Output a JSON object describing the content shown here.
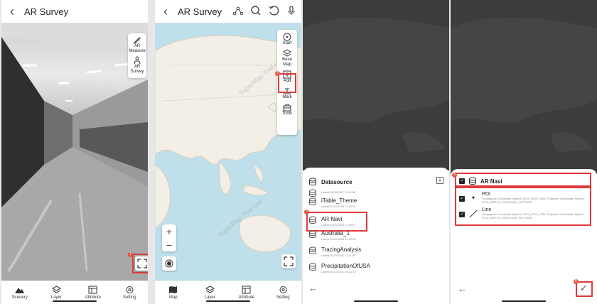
{
  "screen1": {
    "title": "AR Survey",
    "tools": [
      "AR Measure",
      "AR Survey"
    ],
    "badge": "1",
    "tabs": [
      "Scenery",
      "Layer",
      "Attribute",
      "Setting"
    ]
  },
  "screen2": {
    "title": "AR Survey",
    "tools": [
      "Start",
      "Base Map",
      "Add",
      "Mark",
      "Tools"
    ],
    "badge": "2",
    "tabs": [
      "Map",
      "Layer",
      "Attribute",
      "Setting"
    ],
    "watermark": "SuperMap Trial Use"
  },
  "screen3": {
    "heading": "Datasource",
    "badge": "3",
    "items": [
      {
        "name": "",
        "date": "Latest:2022/10/17 11:11:58"
      },
      {
        "name": "iTable_Theme",
        "date": "Latest:2022/10/28 11:15:55"
      },
      {
        "name": "AR Navi",
        "date": "Latest:2022/11/08 17:29:47"
      },
      {
        "name": "Australia_1",
        "date": "Latest:2022/10/28 10:41:53"
      },
      {
        "name": "TracingAnalysis",
        "date": "Latest:2022/10/31 11:11:50"
      },
      {
        "name": "PrecipitationOfUSA",
        "date": "Latest:2022/10/31 16:21:13"
      }
    ]
  },
  "screen4": {
    "group": "AR Navi",
    "badge_group": "4",
    "badge_confirm": "5",
    "layers": [
      {
        "name": "POI",
        "desc": "Geographic Coordinate System: GCS_WGS_1984, Projected Coordinate System: PCS_EARTH_LONGITUDE_LATITUDE"
      },
      {
        "name": "Line",
        "desc": "Geographic Coordinate System: GCS_WGS_1984, Projected Coordinate System: PCS_EARTH_LONGITUDE_LATITUDE"
      }
    ]
  },
  "colors": {
    "highlight": "#e03a3a",
    "badge": "#e5533a",
    "map_water": "#bfe0ea",
    "map_land": "#f3efe6",
    "dark_bg": "#3c3c3c"
  }
}
